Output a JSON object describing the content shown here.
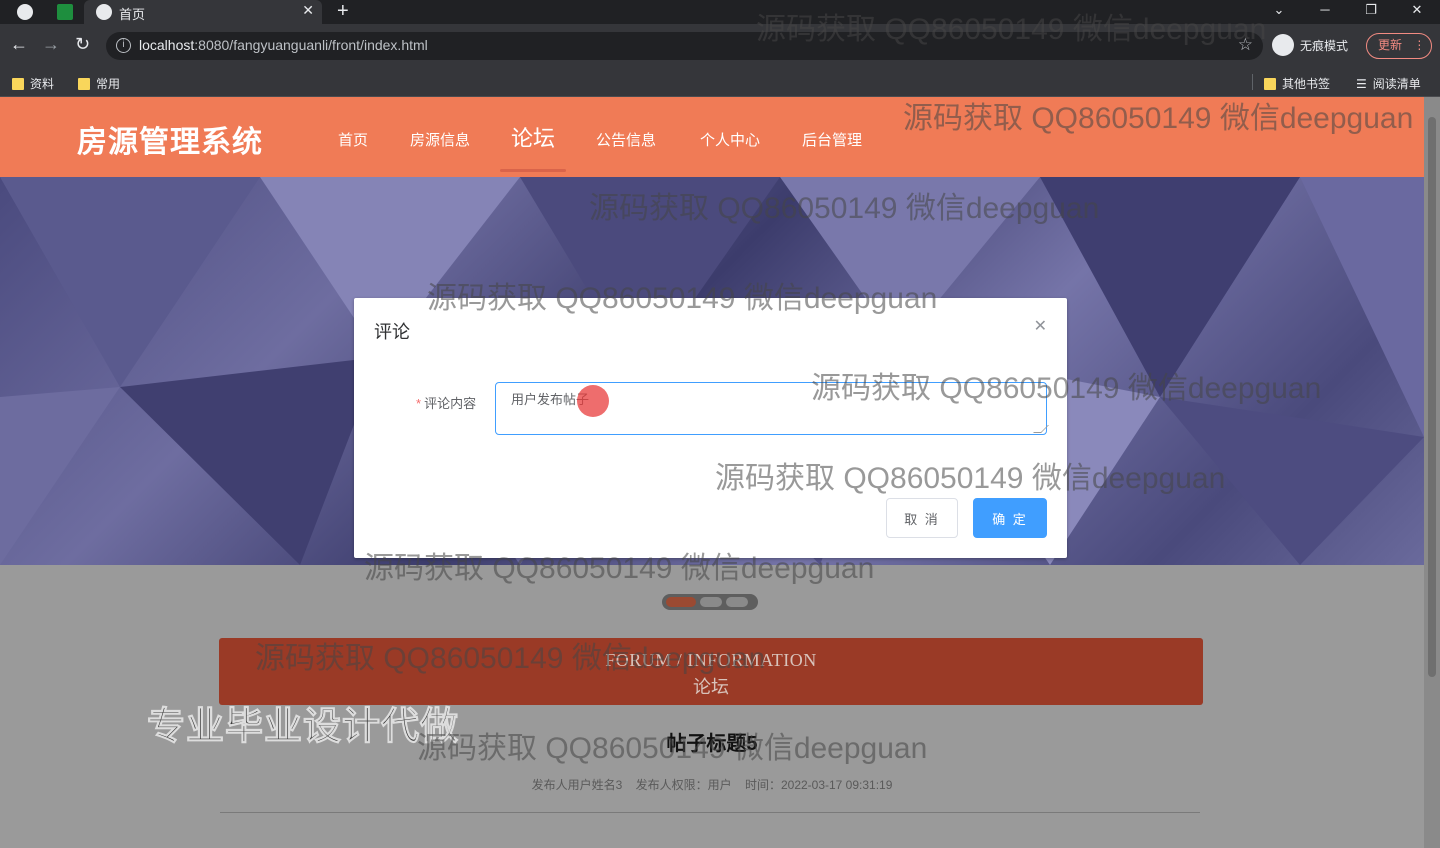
{
  "browser": {
    "tab_title": "首页",
    "url_host": "localhost",
    "url_path": ":8080/fangyuanguanli/front/index.html",
    "incognito_label": "无痕模式",
    "update_label": "更新",
    "bookmarks": [
      "资料",
      "常用"
    ],
    "other_bookmarks": "其他书签",
    "reading_list": "阅读清单"
  },
  "site": {
    "title": "房源管理系统",
    "nav": [
      "首页",
      "房源信息",
      "论坛",
      "公告信息",
      "个人中心",
      "后台管理"
    ],
    "active_nav": "论坛"
  },
  "section": {
    "en": "FORUM / INFORMATION",
    "cn": "论坛"
  },
  "post": {
    "title": "帖子标题5",
    "publisher": "发布人用户姓名3",
    "permission": "发布人权限：用户",
    "time": "时间：2022-03-17 09:31:19"
  },
  "promo": "专业毕业设计代做",
  "dialog": {
    "title": "评论",
    "field_label": "评论内容",
    "field_value": "用户发布帖子",
    "cancel_label": "取 消",
    "ok_label": "确 定"
  },
  "watermark": "源码获取 QQ86050149 微信deepguan",
  "colors": {
    "header": "#f07b56",
    "primary": "#409eff",
    "required": "#f56c6c"
  }
}
